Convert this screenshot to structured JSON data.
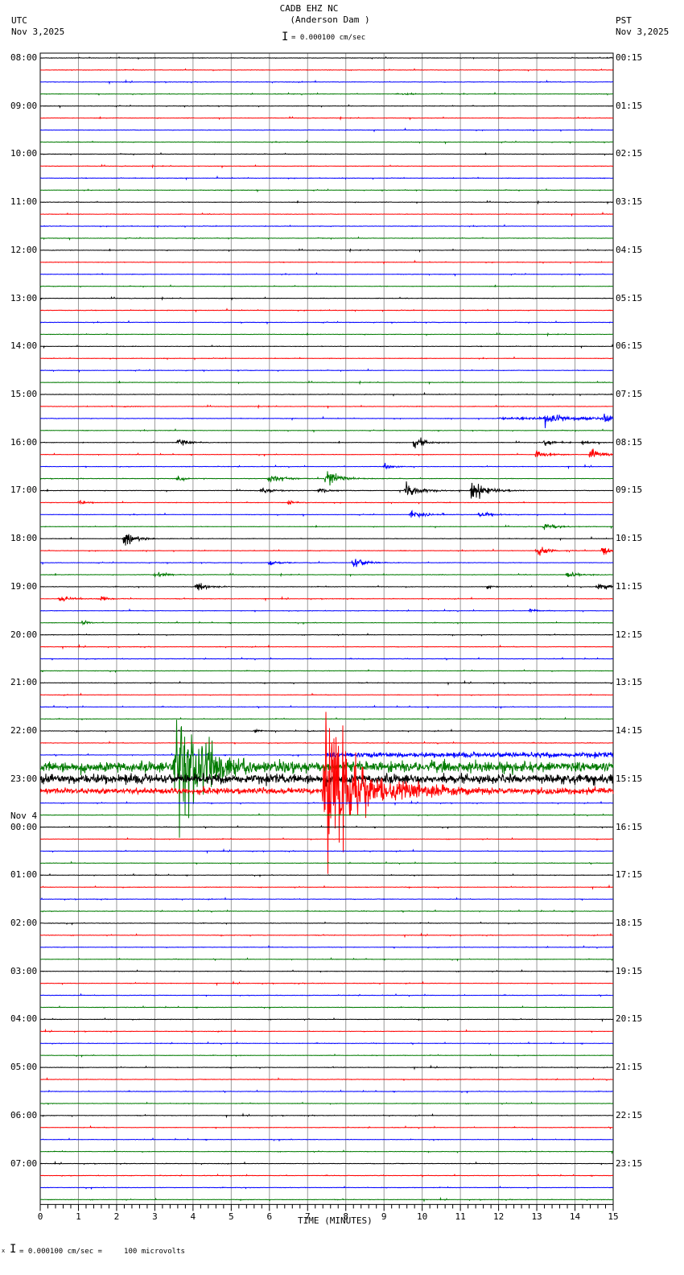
{
  "header": {
    "title": "CADB EHZ NC",
    "subtitle": "(Anderson Dam )",
    "scale": "= 0.000100 cm/sec",
    "left_tz": "UTC",
    "left_date": "Nov 3,2025",
    "right_tz": "PST",
    "right_date": "Nov 3,2025"
  },
  "footer": {
    "scale_note": "= 0.000100 cm/sec =     100 microvolts",
    "marker": "x"
  },
  "chart_data": {
    "type": "line",
    "title": "CADB EHZ NC (Anderson Dam )",
    "xlabel": "TIME (MINUTES)",
    "xlim": [
      0,
      15
    ],
    "x_ticks": [
      "0",
      "1",
      "2",
      "3",
      "4",
      "5",
      "6",
      "7",
      "8",
      "9",
      "10",
      "11",
      "12",
      "13",
      "14",
      "15"
    ],
    "trace_minutes": 15,
    "trace_count": 96,
    "colors": [
      "#000000",
      "#ff0000",
      "#0000ff",
      "#007a00"
    ],
    "left_labels": [
      {
        "trace": 0,
        "text": "08:00"
      },
      {
        "trace": 4,
        "text": "09:00"
      },
      {
        "trace": 8,
        "text": "10:00"
      },
      {
        "trace": 12,
        "text": "11:00"
      },
      {
        "trace": 16,
        "text": "12:00"
      },
      {
        "trace": 20,
        "text": "13:00"
      },
      {
        "trace": 24,
        "text": "14:00"
      },
      {
        "trace": 28,
        "text": "15:00"
      },
      {
        "trace": 32,
        "text": "16:00"
      },
      {
        "trace": 36,
        "text": "17:00"
      },
      {
        "trace": 40,
        "text": "18:00"
      },
      {
        "trace": 44,
        "text": "19:00"
      },
      {
        "trace": 48,
        "text": "20:00"
      },
      {
        "trace": 52,
        "text": "21:00"
      },
      {
        "trace": 56,
        "text": "22:00"
      },
      {
        "trace": 60,
        "text": "23:00"
      },
      {
        "trace": 64,
        "text": "00:00",
        "date": "Nov 4"
      },
      {
        "trace": 68,
        "text": "01:00"
      },
      {
        "trace": 72,
        "text": "02:00"
      },
      {
        "trace": 76,
        "text": "03:00"
      },
      {
        "trace": 80,
        "text": "04:00"
      },
      {
        "trace": 84,
        "text": "05:00"
      },
      {
        "trace": 88,
        "text": "06:00"
      },
      {
        "trace": 92,
        "text": "07:00"
      }
    ],
    "right_labels": [
      "00:15",
      "01:15",
      "02:15",
      "03:15",
      "04:15",
      "05:15",
      "06:15",
      "07:15",
      "08:15",
      "09:15",
      "10:15",
      "11:15",
      "12:15",
      "13:15",
      "14:15",
      "15:15",
      "16:15",
      "17:15",
      "18:15",
      "19:15",
      "20:15",
      "21:15",
      "22:15",
      "23:15"
    ],
    "events": [
      {
        "trace": 3,
        "minute": 9.5,
        "amp": 2,
        "dur": 0.5
      },
      {
        "trace": 29,
        "minute": 2.2,
        "amp": 2,
        "dur": 0.3
      },
      {
        "trace": 30,
        "minute": 13.2,
        "amp": 14,
        "dur": 0.8
      },
      {
        "trace": 30,
        "minute": 14.75,
        "amp": 16,
        "dur": 0.4
      },
      {
        "trace": 32,
        "minute": 3.6,
        "amp": 9,
        "dur": 0.6
      },
      {
        "trace": 32,
        "minute": 9.8,
        "amp": 18,
        "dur": 0.5
      },
      {
        "trace": 32,
        "minute": 13.2,
        "amp": 9,
        "dur": 0.4
      },
      {
        "trace": 32,
        "minute": 14.2,
        "amp": 8,
        "dur": 0.4
      },
      {
        "trace": 33,
        "minute": 13.0,
        "amp": 11,
        "dur": 0.6
      },
      {
        "trace": 33,
        "minute": 14.4,
        "amp": 18,
        "dur": 0.5
      },
      {
        "trace": 34,
        "minute": 9.0,
        "amp": 9,
        "dur": 0.3
      },
      {
        "trace": 35,
        "minute": 3.6,
        "amp": 6,
        "dur": 0.4
      },
      {
        "trace": 35,
        "minute": 6.0,
        "amp": 12,
        "dur": 0.7
      },
      {
        "trace": 35,
        "minute": 7.5,
        "amp": 18,
        "dur": 0.7
      },
      {
        "trace": 36,
        "minute": 5.8,
        "amp": 8,
        "dur": 0.6
      },
      {
        "trace": 36,
        "minute": 7.3,
        "amp": 8,
        "dur": 0.6
      },
      {
        "trace": 36,
        "minute": 9.6,
        "amp": 15,
        "dur": 0.8
      },
      {
        "trace": 36,
        "minute": 11.3,
        "amp": 20,
        "dur": 0.8
      },
      {
        "trace": 37,
        "minute": 1.0,
        "amp": 6,
        "dur": 0.4
      },
      {
        "trace": 37,
        "minute": 6.5,
        "amp": 6,
        "dur": 0.4
      },
      {
        "trace": 38,
        "minute": 9.7,
        "amp": 12,
        "dur": 0.6
      },
      {
        "trace": 38,
        "minute": 11.5,
        "amp": 12,
        "dur": 0.5
      },
      {
        "trace": 39,
        "minute": 13.2,
        "amp": 10,
        "dur": 0.6
      },
      {
        "trace": 40,
        "minute": 2.2,
        "amp": 15,
        "dur": 0.6
      },
      {
        "trace": 41,
        "minute": 13.0,
        "amp": 15,
        "dur": 0.5
      },
      {
        "trace": 41,
        "minute": 14.7,
        "amp": 15,
        "dur": 0.4
      },
      {
        "trace": 42,
        "minute": 6.0,
        "amp": 8,
        "dur": 0.5
      },
      {
        "trace": 42,
        "minute": 8.2,
        "amp": 14,
        "dur": 0.6
      },
      {
        "trace": 43,
        "minute": 3.0,
        "amp": 6,
        "dur": 0.6
      },
      {
        "trace": 43,
        "minute": 13.8,
        "amp": 10,
        "dur": 0.5
      },
      {
        "trace": 44,
        "minute": 4.1,
        "amp": 12,
        "dur": 0.6
      },
      {
        "trace": 44,
        "minute": 11.7,
        "amp": 5,
        "dur": 0.3
      },
      {
        "trace": 44,
        "minute": 14.6,
        "amp": 9,
        "dur": 0.6
      },
      {
        "trace": 45,
        "minute": 0.5,
        "amp": 9,
        "dur": 0.6
      },
      {
        "trace": 45,
        "minute": 1.6,
        "amp": 6,
        "dur": 0.4
      },
      {
        "trace": 46,
        "minute": 12.8,
        "amp": 8,
        "dur": 0.3
      },
      {
        "trace": 47,
        "minute": 1.1,
        "amp": 8,
        "dur": 0.3
      },
      {
        "trace": 56,
        "minute": 5.6,
        "amp": 5,
        "dur": 0.3
      },
      {
        "trace": 56,
        "minute": 7.0,
        "amp": 3,
        "dur": 0.3
      },
      {
        "trace": 59,
        "minute": 3.6,
        "amp": 200,
        "dur": 1.2
      },
      {
        "trace": 61,
        "minute": 7.5,
        "amp": 240,
        "dur": 1.4
      },
      {
        "trace": 61,
        "minute": 9.5,
        "amp": 12,
        "dur": 2.5
      }
    ],
    "noisy_segments": [
      {
        "trace": 30,
        "from": 12.0,
        "to": 15,
        "amp": 2
      },
      {
        "trace": 58,
        "from": 7.5,
        "to": 15,
        "amp": 5
      },
      {
        "trace": 59,
        "from": 0,
        "to": 15,
        "amp": 11
      },
      {
        "trace": 60,
        "from": 0,
        "to": 15,
        "amp": 10
      },
      {
        "trace": 61,
        "from": 0,
        "to": 15,
        "amp": 6
      }
    ]
  }
}
